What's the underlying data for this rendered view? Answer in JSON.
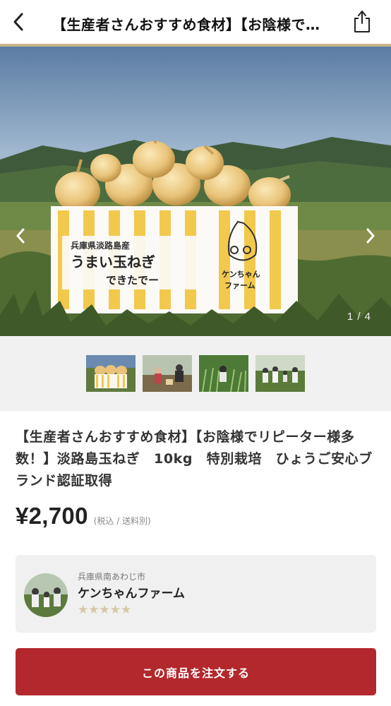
{
  "header": {
    "title": "【生産者さんおすすめ食材】【お陰様でリピーター様多数！】淡路島玉ねぎ　10kg　特別栽培　ひょうご安心ブランド認証取得",
    "back_icon": "chevron-left-icon",
    "share_icon": "share-icon"
  },
  "carousel": {
    "counter": "1 / 4",
    "box_label_line1": "兵庫県淡路島産",
    "box_label_line2": "うまい玉ねぎ",
    "box_label_line3": "できたでー",
    "box_logo_line1": "ケンちゃん",
    "box_logo_line2": "ファーム",
    "prev_icon": "chevron-left-icon",
    "next_icon": "chevron-right-icon"
  },
  "thumbnails": [
    {
      "name": "thumbnail-1"
    },
    {
      "name": "thumbnail-2"
    },
    {
      "name": "thumbnail-3"
    },
    {
      "name": "thumbnail-4"
    }
  ],
  "product": {
    "title": "【生産者さんおすすめ食材】【お陰様でリピーター様多数！】淡路島玉ねぎ　10kg　特別栽培　ひょうご安心ブランド認証取得",
    "price": "¥2,700",
    "price_note": "(税込 / 送料別)"
  },
  "producer": {
    "location": "兵庫県南あわじ市",
    "name": "ケンちゃんファーム",
    "stars": "★★★★★",
    "rating": 5
  },
  "actions": {
    "order_label": "この商品を注文する"
  },
  "colors": {
    "accent": "#b3282d",
    "gold": "#c8b489",
    "box_stripe": "#f2c94c"
  }
}
